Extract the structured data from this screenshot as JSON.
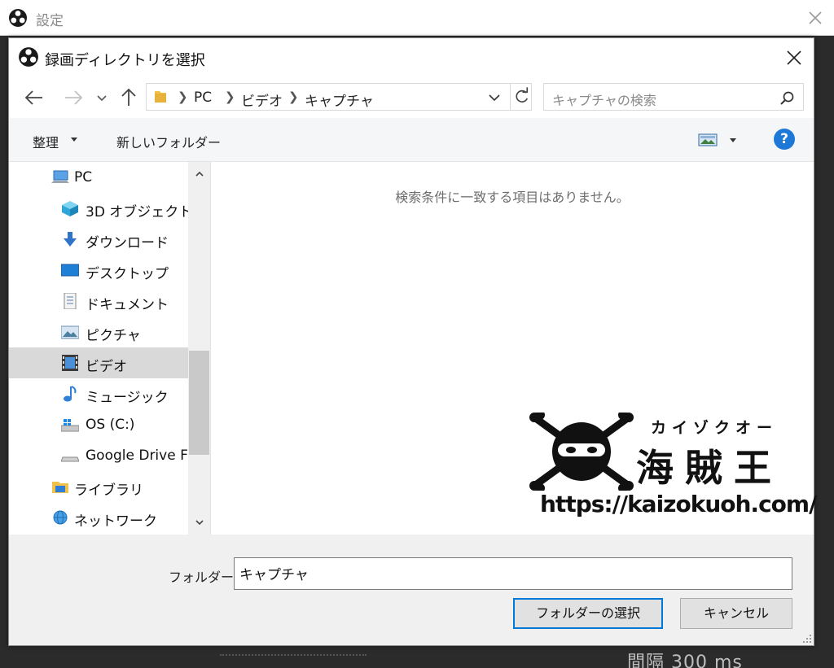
{
  "outer_window": {
    "title": "設定",
    "partial_text": "間隔 300 ms"
  },
  "dialog": {
    "title": "録画ディレクトリを選択"
  },
  "address_bar": {
    "crumbs": [
      "PC",
      "ビデオ",
      "キャプチャ"
    ]
  },
  "search": {
    "placeholder": "キャプチャの検索"
  },
  "toolbar": {
    "organize_label": "整理",
    "new_folder_label": "新しいフォルダー",
    "help_label": "?"
  },
  "nav_pane": {
    "items": [
      {
        "label": "PC",
        "icon": "pc-icon",
        "selected": false
      },
      {
        "label": "3D オブジェクト",
        "icon": "3d-objects-icon",
        "selected": false
      },
      {
        "label": "ダウンロード",
        "icon": "download-icon",
        "selected": false
      },
      {
        "label": "デスクトップ",
        "icon": "desktop-icon",
        "selected": false
      },
      {
        "label": "ドキュメント",
        "icon": "documents-icon",
        "selected": false
      },
      {
        "label": "ピクチャ",
        "icon": "pictures-icon",
        "selected": false
      },
      {
        "label": "ビデオ",
        "icon": "videos-icon",
        "selected": true
      },
      {
        "label": "ミュージック",
        "icon": "music-icon",
        "selected": false
      },
      {
        "label": "OS (C:)",
        "icon": "drive-icon",
        "selected": false
      },
      {
        "label": "Google Drive F",
        "icon": "drive-icon",
        "selected": false
      },
      {
        "label": "ライブラリ",
        "icon": "library-icon",
        "selected": false
      },
      {
        "label": "ネットワーク",
        "icon": "network-icon",
        "selected": false
      }
    ]
  },
  "content": {
    "empty_message": "検索条件に一致する項目はありません。"
  },
  "watermark": {
    "kana": "カイゾクオー",
    "brand": "海賊王",
    "url": "https://kaizokuoh.com/"
  },
  "footer": {
    "folder_label": "フォルダー:",
    "folder_value": "キャプチャ",
    "select_button": "フォルダーの選択",
    "cancel_button": "キャンセル"
  },
  "colors": {
    "accent": "#0078d7",
    "help": "#1e78d7",
    "selected_row": "#d9d9d9"
  }
}
